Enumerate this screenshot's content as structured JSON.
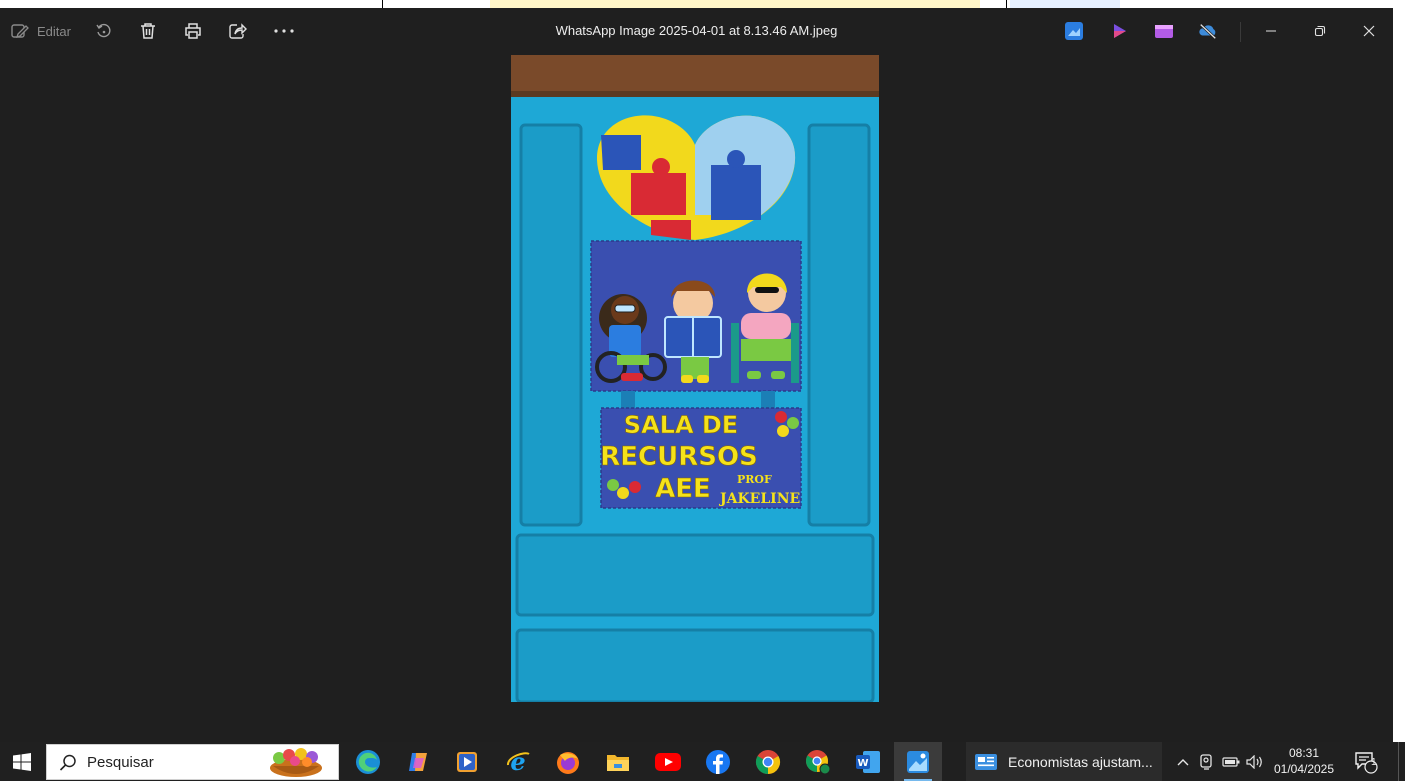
{
  "window": {
    "title": "WhatsApp Image 2025-04-01 at 8.13.46 AM.jpeg"
  },
  "toolbar": {
    "edit_label": "Editar",
    "icons": [
      "edit-icon",
      "rotate-icon",
      "delete-icon",
      "print-icon",
      "share-icon",
      "more-icon"
    ],
    "app_icons": [
      "photo-editor-icon",
      "clipchamp-icon",
      "video-editor-icon",
      "onedrive-off-icon"
    ],
    "window_controls": [
      "minimize-icon",
      "restore-icon",
      "close-icon"
    ]
  },
  "photo": {
    "sign_line1": "SALA DE",
    "sign_line2": "RECURSOS",
    "sign_line3": "AEE",
    "sign_prof": "PROF",
    "sign_name": "JAKELINE"
  },
  "taskbar": {
    "search_placeholder": "Pesquisar",
    "pinned_apps": [
      "edge-icon",
      "copilot-icon",
      "media-player-icon",
      "internet-explorer-icon",
      "firefox-icon",
      "file-explorer-icon",
      "youtube-icon",
      "facebook-icon",
      "chrome-icon",
      "chrome-profile-icon",
      "word-icon",
      "photos-icon"
    ],
    "window_label": "Economistas ajustam...",
    "clock_time": "08:31",
    "clock_date": "01/04/2025",
    "notification_count": "1"
  },
  "colors": {
    "window_bg": "#1f1f1f",
    "taskbar_bg": "#202020",
    "door_blue": "#1ea8d6",
    "sign_navy": "#3a4fb0",
    "sign_yellow": "#f5e21a"
  }
}
